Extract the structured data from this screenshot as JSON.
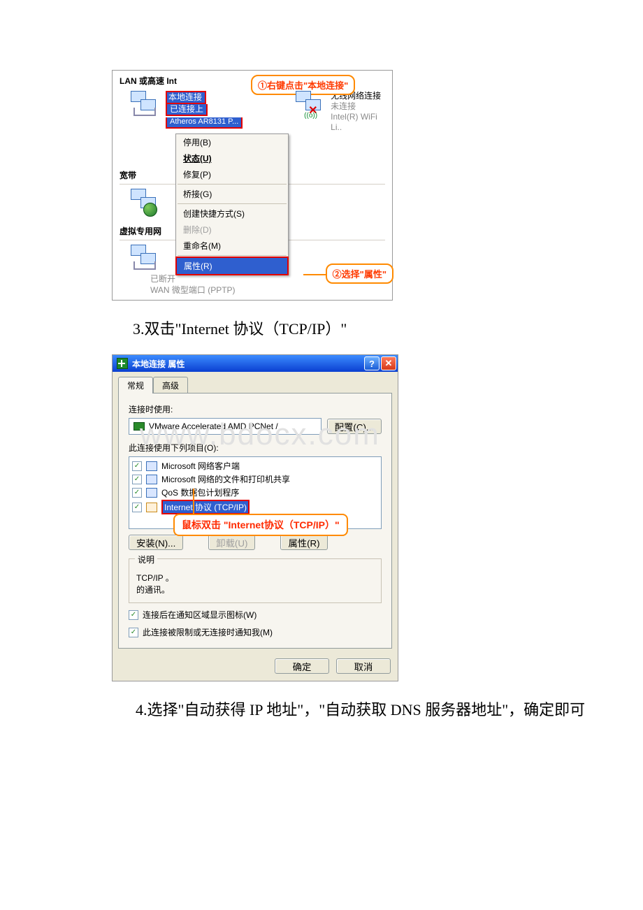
{
  "sshot1": {
    "section_lan": "LAN 或高速 Int",
    "callout1": "①右键点击\"本地连接\"",
    "local_conn_name": "本地连接",
    "local_conn_status": "已连接上",
    "local_conn_adapter": "Atheros AR8131 P...",
    "wifi_name": "无线网络连接",
    "wifi_status": "未连接",
    "wifi_adapter": "Intel(R) WiFi Li..",
    "menu": {
      "disable": "停用(B)",
      "status": "状态(U)",
      "repair": "修复(P)",
      "bridge": "桥接(G)",
      "shortcut": "创建快捷方式(S)",
      "delete": "删除(D)",
      "rename": "重命名(M)",
      "properties": "属性(R)"
    },
    "section_broadband": "宽带",
    "section_vpn": "虚拟专用网",
    "callout2": "②选择\"属性\"",
    "bottom_status": "已断开",
    "bottom_adapter": "WAN 微型端口 (PPTP)"
  },
  "step3": "3.双击\"Internet 协议（TCP/IP）\"",
  "sshot2": {
    "title": "本地连接 属性",
    "tab_general": "常规",
    "tab_advanced": "高级",
    "use_label": "连接时使用:",
    "adapter": "VMware Accelerated AMD PCNet /",
    "configure_btn": "配置(C)...",
    "items_label": "此连接使用下列项目(O):",
    "item_client": "Microsoft 网络客户端",
    "item_fps": "Microsoft 网络的文件和打印机共享",
    "item_qos": "QoS 数据包计划程序",
    "item_tcp": "Internet 协议 (TCP/IP)",
    "install_btn": "安装(N)...",
    "uninstall_btn": "卸载(U)",
    "prop_btn": "属性(R)",
    "callout3": "鼠标双击 \"Internet协议（TCP/IP）\"",
    "desc_legend": "说明",
    "desc_text": "TCP/IP 。\n的通讯。",
    "chk_tray": "连接后在通知区域显示图标(W)",
    "chk_notify": "此连接被限制或无连接时通知我(M)",
    "ok_btn": "确定",
    "cancel_btn": "取消"
  },
  "step4": "　　4.选择\"自动获得 IP 地址\"，\"自动获取 DNS 服务器地址\"，确定即可",
  "watermark": "www.bdocx.com"
}
